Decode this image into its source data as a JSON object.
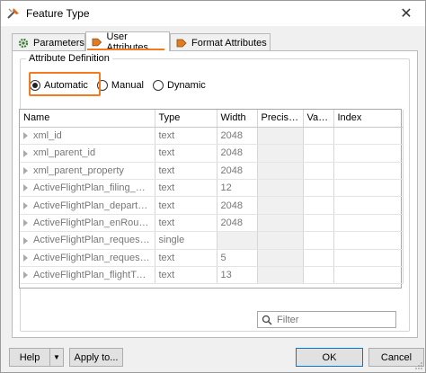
{
  "window": {
    "title": "Feature Type",
    "close_glyph": "✕"
  },
  "tabs": [
    {
      "label": "Parameters",
      "icon": "gear-icon",
      "active": false
    },
    {
      "label": "User Attributes",
      "icon": "attribute-tag-icon",
      "active": true
    },
    {
      "label": "Format Attributes",
      "icon": "attribute-tag-icon",
      "active": false
    }
  ],
  "attribute_definition": {
    "title": "Attribute Definition",
    "options": [
      "Automatic",
      "Manual",
      "Dynamic"
    ],
    "selected": "Automatic"
  },
  "table": {
    "columns": [
      "Name",
      "Type",
      "Width",
      "Precision",
      "Value",
      "Index"
    ],
    "rows": [
      {
        "name": "xml_id",
        "type": "text",
        "width": "2048",
        "precision": "",
        "value": "",
        "index": ""
      },
      {
        "name": "xml_parent_id",
        "type": "text",
        "width": "2048",
        "precision": "",
        "value": "",
        "index": ""
      },
      {
        "name": "xml_parent_property",
        "type": "text",
        "width": "2048",
        "precision": "",
        "value": "",
        "index": ""
      },
      {
        "name": "ActiveFlightPlan_filing_accep...",
        "type": "text",
        "width": "12",
        "precision": "",
        "value": "",
        "index": ""
      },
      {
        "name": "ActiveFlightPlan_departure_e...",
        "type": "text",
        "width": "2048",
        "precision": "",
        "value": "",
        "index": ""
      },
      {
        "name": "ActiveFlightPlan_enRoute_alt...",
        "type": "text",
        "width": "2048",
        "precision": "",
        "value": "",
        "index": ""
      },
      {
        "name": "ActiveFlightPlan_request_airs...",
        "type": "single",
        "width": "",
        "precision": "",
        "value": "",
        "index": ""
      },
      {
        "name": "ActiveFlightPlan_request_airs...",
        "type": "text",
        "width": "5",
        "precision": "",
        "value": "",
        "index": ""
      },
      {
        "name": "ActiveFlightPlan_flightType",
        "type": "text",
        "width": "13",
        "precision": "",
        "value": "",
        "index": ""
      }
    ]
  },
  "filter": {
    "placeholder": "Filter",
    "icon": "search-icon"
  },
  "buttons": {
    "help": "Help",
    "help_menu": "▼",
    "apply_to": "Apply to...",
    "ok": "OK",
    "cancel": "Cancel"
  },
  "colors": {
    "highlight": "#f47a20",
    "primary_border": "#0078d7"
  }
}
